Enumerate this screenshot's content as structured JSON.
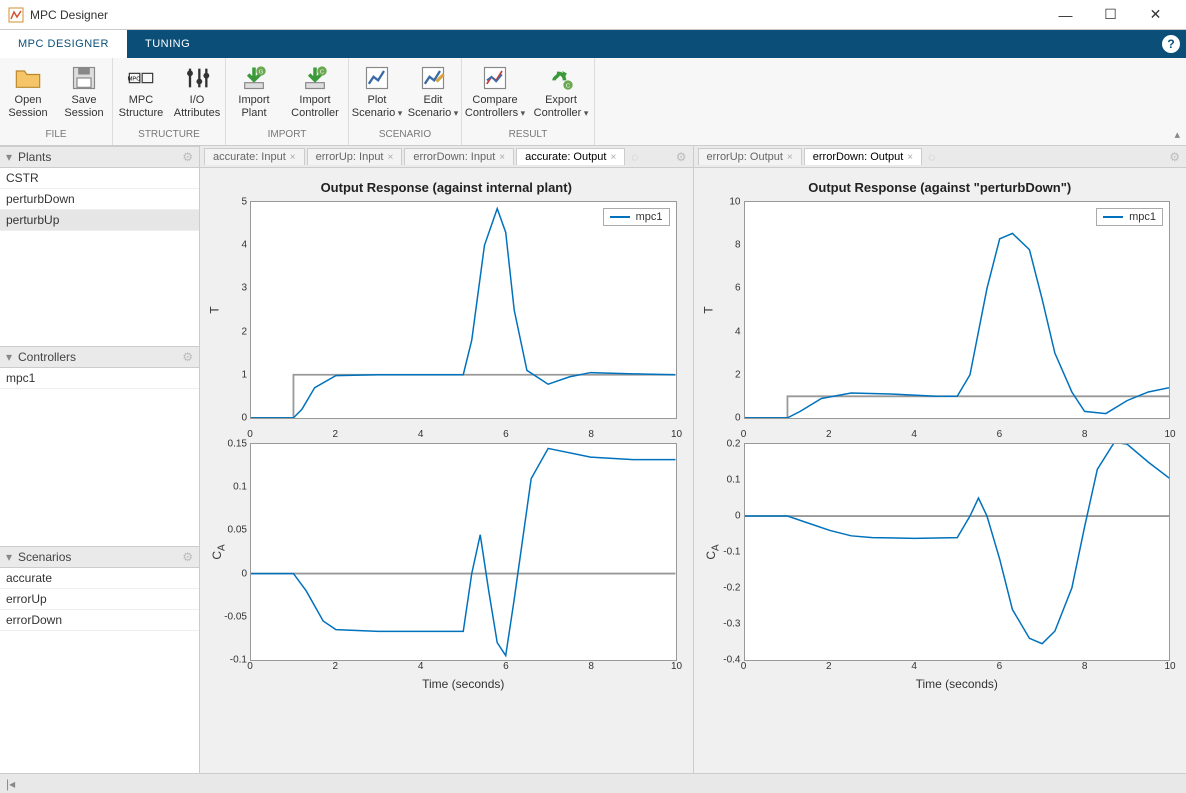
{
  "window": {
    "title": "MPC Designer"
  },
  "tabs": {
    "designer": "MPC DESIGNER",
    "tuning": "TUNING"
  },
  "ribbon": {
    "file_group": "FILE",
    "structure_group": "STRUCTURE",
    "import_group": "IMPORT",
    "scenario_group": "SCENARIO",
    "result_group": "RESULT",
    "open_session": "Open\nSession",
    "save_session": "Save\nSession",
    "mpc_structure": "MPC\nStructure",
    "io_attributes": "I/O\nAttributes",
    "import_plant": "Import\nPlant",
    "import_controller": "Import\nController",
    "plot_scenario": "Plot\nScenario",
    "edit_scenario": "Edit\nScenario",
    "compare_controllers": "Compare\nControllers",
    "export_controller": "Export\nController"
  },
  "panels": {
    "plants": "Plants",
    "controllers": "Controllers",
    "scenarios": "Scenarios"
  },
  "plants": [
    "CSTR",
    "perturbDown",
    "perturbUp"
  ],
  "controllers": [
    "mpc1"
  ],
  "scenarios": [
    "accurate",
    "errorUp",
    "errorDown"
  ],
  "plot_tabs_left": [
    "accurate: Input",
    "errorUp: Input",
    "errorDown: Input",
    "accurate: Output"
  ],
  "plot_tabs_right": [
    "errorUp: Output",
    "errorDown: Output"
  ],
  "charts": {
    "left": {
      "title": "Output Response (against internal plant)",
      "legend": "mpc1",
      "top_ylabel": "T",
      "bot_ylabel": "C_A",
      "xlabel": "Time (seconds)"
    },
    "right": {
      "title": "Output Response (against \"perturbDown\")",
      "legend": "mpc1",
      "top_ylabel": "T",
      "bot_ylabel": "C_A",
      "xlabel": "Time (seconds)"
    }
  },
  "chart_data": [
    {
      "type": "line",
      "title": "Output Response (against internal plant) — T",
      "xlabel": "Time (seconds)",
      "ylabel": "T",
      "xlim": [
        0,
        10
      ],
      "ylim": [
        0,
        5
      ],
      "yticks": [
        0,
        1,
        2,
        3,
        4,
        5
      ],
      "xticks": [
        0,
        2,
        4,
        6,
        8,
        10
      ],
      "series": [
        {
          "name": "ref",
          "x": [
            0,
            1,
            1,
            10
          ],
          "y": [
            0,
            0,
            1,
            1
          ]
        },
        {
          "name": "mpc1",
          "x": [
            0,
            1,
            1.2,
            1.5,
            2,
            3,
            4,
            5,
            5.2,
            5.5,
            5.8,
            6,
            6.2,
            6.5,
            7,
            7.5,
            8,
            9,
            10
          ],
          "y": [
            0,
            0,
            0.2,
            0.7,
            0.98,
            1.0,
            1.0,
            1.0,
            1.8,
            4.0,
            4.85,
            4.3,
            2.5,
            1.1,
            0.78,
            0.95,
            1.05,
            1.02,
            1.0
          ]
        }
      ]
    },
    {
      "type": "line",
      "title": "Output Response (against internal plant) — C_A",
      "xlabel": "Time (seconds)",
      "ylabel": "C_A",
      "xlim": [
        0,
        10
      ],
      "ylim": [
        -0.1,
        0.15
      ],
      "yticks": [
        -0.1,
        -0.05,
        0,
        0.05,
        0.1,
        0.15
      ],
      "xticks": [
        0,
        2,
        4,
        6,
        8,
        10
      ],
      "series": [
        {
          "name": "ref",
          "x": [
            0,
            10
          ],
          "y": [
            0,
            0
          ]
        },
        {
          "name": "mpc1",
          "x": [
            0,
            1,
            1.3,
            1.7,
            2,
            3,
            4,
            5,
            5.2,
            5.4,
            5.6,
            5.8,
            6,
            6.2,
            6.6,
            7,
            8,
            9,
            10
          ],
          "y": [
            0,
            0,
            -0.02,
            -0.055,
            -0.065,
            -0.067,
            -0.067,
            -0.067,
            0.0,
            0.045,
            -0.02,
            -0.08,
            -0.095,
            -0.03,
            0.11,
            0.145,
            0.135,
            0.132,
            0.132
          ]
        }
      ]
    },
    {
      "type": "line",
      "title": "Output Response (against \"perturbDown\") — T",
      "xlabel": "Time (seconds)",
      "ylabel": "T",
      "xlim": [
        0,
        10
      ],
      "ylim": [
        0,
        10
      ],
      "yticks": [
        0,
        2,
        4,
        6,
        8,
        10
      ],
      "xticks": [
        0,
        2,
        4,
        6,
        8,
        10
      ],
      "series": [
        {
          "name": "ref",
          "x": [
            0,
            1,
            1,
            10
          ],
          "y": [
            0,
            0,
            1,
            1
          ]
        },
        {
          "name": "mpc1",
          "x": [
            0,
            1,
            1.3,
            1.8,
            2.5,
            3.5,
            4.5,
            5,
            5.3,
            5.7,
            6,
            6.3,
            6.7,
            7,
            7.3,
            7.7,
            8,
            8.5,
            9,
            9.5,
            10
          ],
          "y": [
            0,
            0,
            0.3,
            0.9,
            1.15,
            1.1,
            1.0,
            1.0,
            2.0,
            6.0,
            8.3,
            8.55,
            7.8,
            5.5,
            3.0,
            1.2,
            0.3,
            0.2,
            0.8,
            1.2,
            1.4
          ]
        }
      ]
    },
    {
      "type": "line",
      "title": "Output Response (against \"perturbDown\") — C_A",
      "xlabel": "Time (seconds)",
      "ylabel": "C_A",
      "xlim": [
        0,
        10
      ],
      "ylim": [
        -0.4,
        0.2
      ],
      "yticks": [
        -0.4,
        -0.3,
        -0.2,
        -0.1,
        0,
        0.1,
        0.2
      ],
      "xticks": [
        0,
        2,
        4,
        6,
        8,
        10
      ],
      "series": [
        {
          "name": "ref",
          "x": [
            0,
            10
          ],
          "y": [
            0,
            0
          ]
        },
        {
          "name": "mpc1",
          "x": [
            0,
            1,
            1.5,
            2,
            2.5,
            3,
            4,
            5,
            5.3,
            5.5,
            5.7,
            6,
            6.3,
            6.7,
            7,
            7.3,
            7.7,
            8,
            8.3,
            8.7,
            9,
            9.5,
            10
          ],
          "y": [
            0,
            0,
            -0.02,
            -0.04,
            -0.055,
            -0.06,
            -0.062,
            -0.06,
            0.0,
            0.05,
            0.0,
            -0.12,
            -0.26,
            -0.34,
            -0.355,
            -0.32,
            -0.2,
            -0.03,
            0.13,
            0.205,
            0.2,
            0.15,
            0.105
          ]
        }
      ]
    }
  ]
}
